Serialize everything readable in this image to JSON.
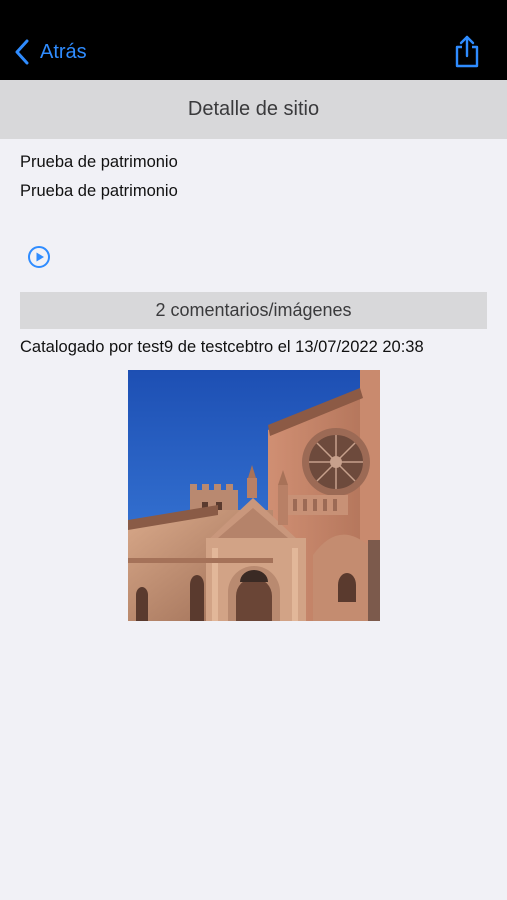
{
  "nav": {
    "back_label": "Atrás",
    "back_icon": "chevron-left-icon",
    "share_icon": "share-icon",
    "accent_color": "#2f8cff"
  },
  "title_bar": {
    "title": "Detalle de sitio"
  },
  "site": {
    "name": "Prueba de patrimonio",
    "description": "Prueba de patrimonio"
  },
  "audio": {
    "icon": "play-circle-icon"
  },
  "comments": {
    "label": "2 comentarios/imágenes"
  },
  "catalog": {
    "text": "Catalogado por test9 de testcebtro el 13/07/2022 20:38"
  },
  "photo": {
    "subject": "cathedral-photo"
  }
}
